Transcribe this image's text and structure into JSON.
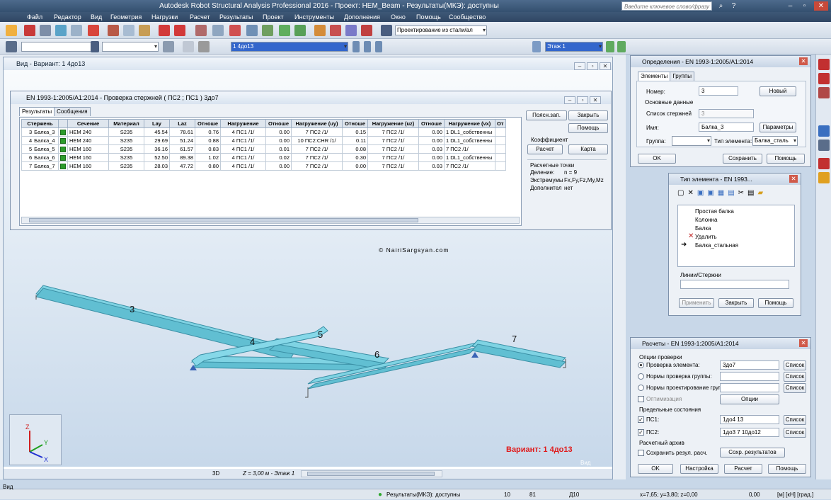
{
  "window": {
    "title": "Autodesk Robot Structural Analysis Professional 2016 - Проект: HEM_Beam - Результаты(МКЭ): доступны",
    "search_placeholder": "Введите ключевое слово/фразу"
  },
  "menu": [
    "Файл",
    "Редактор",
    "Вид",
    "Геометрия",
    "Нагрузки",
    "Расчет",
    "Результаты",
    "Проект",
    "Инструменты",
    "Дополнения",
    "Окно",
    "Помощь",
    "Сообщество"
  ],
  "toolbar": {
    "design_combo": "Проектирование из стали/ал",
    "case_combo": "1 4до13",
    "story_combo": "Этаж 1"
  },
  "view": {
    "title": "Вид - Вариант: 1 4до13",
    "copyright": "© NairiSargsyan.com",
    "variant_label": "Вариант: 1 4до13",
    "mode_3d": "3D",
    "z_level": "Z = 3,00 м - Этаж 1",
    "corner": "Вид",
    "member_numbers": [
      "3",
      "4",
      "5",
      "6",
      "7"
    ],
    "axes": {
      "z": "Z",
      "y": "Y",
      "x": "X"
    }
  },
  "check_window": {
    "title": "EN 1993-1:2005/A1:2014 - Проверка стержней ( ПС2 ; ПС1 ) 3до7",
    "tabs": [
      "Результаты",
      "Сообщения"
    ],
    "columns": [
      "Стержень",
      "",
      "Сечение",
      "Материал",
      "Lay",
      "Laz",
      "Отноше",
      "Нагружение",
      "Отноше",
      "Нагружение (uy)",
      "Отноше",
      "Нагружение (uz)",
      "Отноше",
      "Нагружение (vx)",
      "От"
    ],
    "rows": [
      [
        "3",
        "Балка_3",
        "HEM 240",
        "S235",
        "45.54",
        "78.61",
        "0.76",
        "4 ПС1 /1/",
        "0.00",
        "7 ПС2 /1/",
        "0.15",
        "7 ПС2 /1/",
        "0.00",
        "1 DL1_собственны"
      ],
      [
        "4",
        "Балка_4",
        "HEM 240",
        "S235",
        "29.69",
        "51.24",
        "0.88",
        "4 ПС1 /1/",
        "0.00",
        "10 ПС2:CHR /1/",
        "0.11",
        "7 ПС2 /1/",
        "0.00",
        "1 DL1_собственны"
      ],
      [
        "5",
        "Балка_5",
        "HEM 160",
        "S235",
        "36.16",
        "61.57",
        "0.83",
        "4 ПС1 /1/",
        "0.01",
        "7 ПС2 /1/",
        "0.08",
        "7 ПС2 /1/",
        "0.03",
        "7 ПС2 /1/"
      ],
      [
        "6",
        "Балка_6",
        "HEM 160",
        "S235",
        "52.50",
        "89.38",
        "1.02",
        "4 ПС1 /1/",
        "0.02",
        "7 ПС2 /1/",
        "0.30",
        "7 ПС2 /1/",
        "0.00",
        "1 DL1_собственны"
      ],
      [
        "7",
        "Балка_7",
        "HEM 160",
        "S235",
        "28.03",
        "47.72",
        "0.80",
        "4 ПС1 /1/",
        "0.00",
        "7 ПС2 /1/",
        "0.00",
        "7 ПС2 /1/",
        "0.03",
        "7 ПС2 /1/"
      ]
    ],
    "buttons": {
      "notes": "Поясн.зап.",
      "close": "Закрыть",
      "help": "Помощь",
      "calc": "Расчет",
      "map": "Карта"
    },
    "coef_label": "Коэффициент",
    "points": {
      "title": "Расчетные точки",
      "div_label": "Деление:",
      "div_value": "n = 9",
      "ext_label": "Экстремумы",
      "ext_value": "Fx,Fy,Fz,My,Mz",
      "add_label": "Дополнител",
      "add_value": "нет"
    }
  },
  "definitions": {
    "title": "Определения - EN 1993-1:2005/A1:2014",
    "tabs": [
      "Элементы",
      "Группы"
    ],
    "number_label": "Номер:",
    "number_value": "3",
    "new_btn": "Новый",
    "basic_label": "Основные данные",
    "members_label": "Список стержней",
    "members_value": "3",
    "name_label": "Имя:",
    "name_value": "Балка_3",
    "params_btn": "Параметры",
    "group_label": "Группа:",
    "type_label": "Тип элемента:",
    "type_value": "Балка_сталь",
    "ok": "OK",
    "save": "Сохранить",
    "help": "Помощь"
  },
  "element_type": {
    "title": "Тип элемента - EN 1993...",
    "items": [
      "Простая балка",
      "Колонна",
      "Балка",
      "Удалить",
      "Балка_стальная"
    ],
    "lines_label": "Линии/Стержни",
    "apply": "Применить",
    "close": "Закрыть",
    "help": "Помощь"
  },
  "calcs": {
    "title": "Расчеты - EN 1993-1:2005/A1:2014",
    "options_label": "Опции проверки",
    "r1": "Проверка элемента:",
    "r1_value": "3до7",
    "r2": "Нормы проверка группы:",
    "r3": "Нормы проектирование груп",
    "list": "Список",
    "opt_label": "Оптимизация",
    "options_btn": "Опции",
    "limit_label": "Предельные состояния",
    "ps1": "ПС1:",
    "ps1_value": "1до4 13",
    "ps2": "ПС2:",
    "ps2_value": "1до3 7 10до12",
    "archive_label": "Расчетный архив",
    "save_chk": "Сохранить резул. расч.",
    "save_btn": "Сохр. результатов",
    "ok": "OK",
    "setup": "Настройка",
    "calc": "Расчет",
    "help": "Помощь"
  },
  "status": {
    "left": "Вид",
    "results": "Результаты(МКЭ): доступны",
    "n1": "10",
    "n2": "81",
    "n3": "Д10",
    "coords": "x=7,65; y=3,80; z=0,00",
    "val": "0,00",
    "units": "[м] [кН] [град.]"
  },
  "colors": {
    "beam": "#7fd3e3",
    "beam_edge": "#3a8fa5",
    "variant_red": "#e01a1a",
    "title_blue": "#2f4663"
  }
}
